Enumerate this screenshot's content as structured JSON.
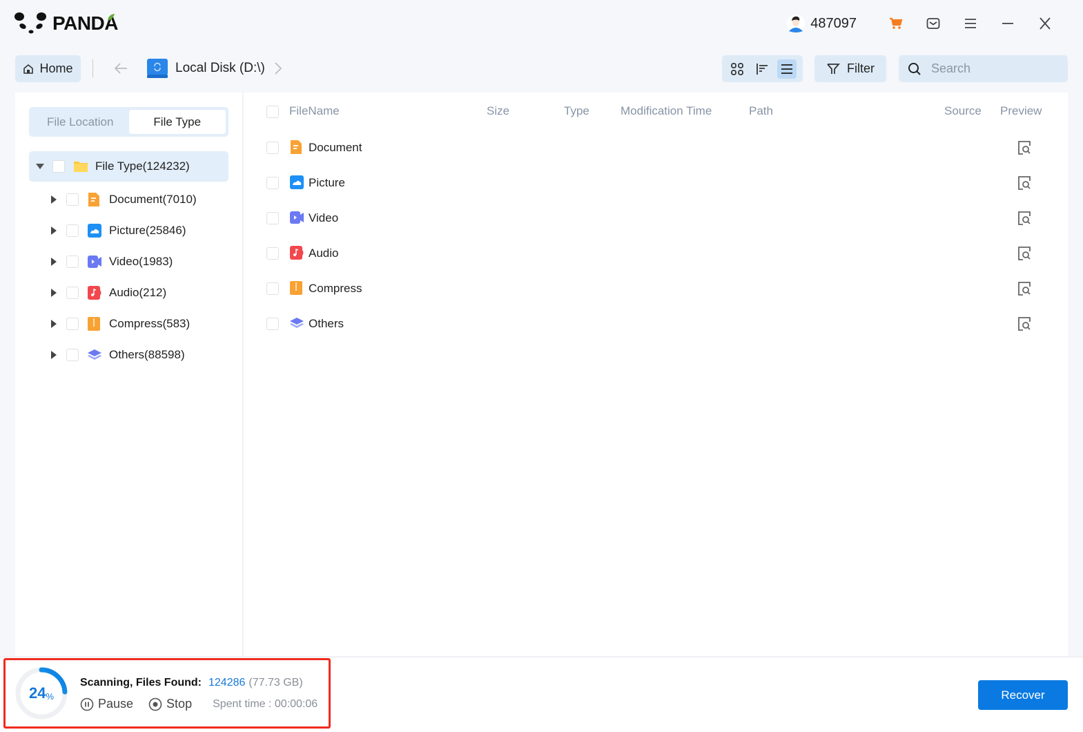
{
  "app": {
    "logo_text": "PANDA",
    "user_id": "487097"
  },
  "titlebar_icons": [
    "avatar-icon",
    "cart-icon",
    "mail-icon",
    "menu-icon",
    "minimize-icon",
    "close-icon"
  ],
  "nav": {
    "home_label": "Home",
    "location_label": "Local Disk (D:\\)",
    "view_modes": [
      "grid",
      "sort",
      "list"
    ],
    "active_view": "list",
    "filter_label": "Filter",
    "search_placeholder": "Search",
    "search_value": ""
  },
  "sidebar": {
    "tabs": [
      {
        "label": "File Location",
        "active": false
      },
      {
        "label": "File Type",
        "active": true
      }
    ],
    "root": {
      "label": "File Type(124232)",
      "expanded": true
    },
    "items": [
      {
        "label": "Document(7010)",
        "icon": "document",
        "color": "#f9a234"
      },
      {
        "label": "Picture(25846)",
        "icon": "picture",
        "color": "#1e90f5"
      },
      {
        "label": "Video(1983)",
        "icon": "video",
        "color": "#6b79f2"
      },
      {
        "label": "Audio(212)",
        "icon": "audio",
        "color": "#f2474e"
      },
      {
        "label": "Compress(583)",
        "icon": "compress",
        "color": "#f9a234"
      },
      {
        "label": "Others(88598)",
        "icon": "others",
        "color": "#6b79f2"
      }
    ]
  },
  "table": {
    "columns": [
      "FileName",
      "Size",
      "Type",
      "Modification Time",
      "Path",
      "Source",
      "Preview"
    ],
    "rows": [
      {
        "name": "Document",
        "icon": "document"
      },
      {
        "name": "Picture",
        "icon": "picture"
      },
      {
        "name": "Video",
        "icon": "video"
      },
      {
        "name": "Audio",
        "icon": "audio"
      },
      {
        "name": "Compress",
        "icon": "compress"
      },
      {
        "name": "Others",
        "icon": "others"
      }
    ]
  },
  "scan": {
    "progress_percent": 24,
    "percent_text": "24",
    "percent_sign": "%",
    "title": "Scanning, Files Found:",
    "files_found": "124286",
    "size": "(77.73 GB)",
    "pause_label": "Pause",
    "stop_label": "Stop",
    "spent_time": "Spent time : 00:00:06"
  },
  "recover_label": "Recover",
  "colors": {
    "accent": "#0a7ae2",
    "highlight_border": "#f02a1e",
    "cart": "#f57c1f"
  }
}
